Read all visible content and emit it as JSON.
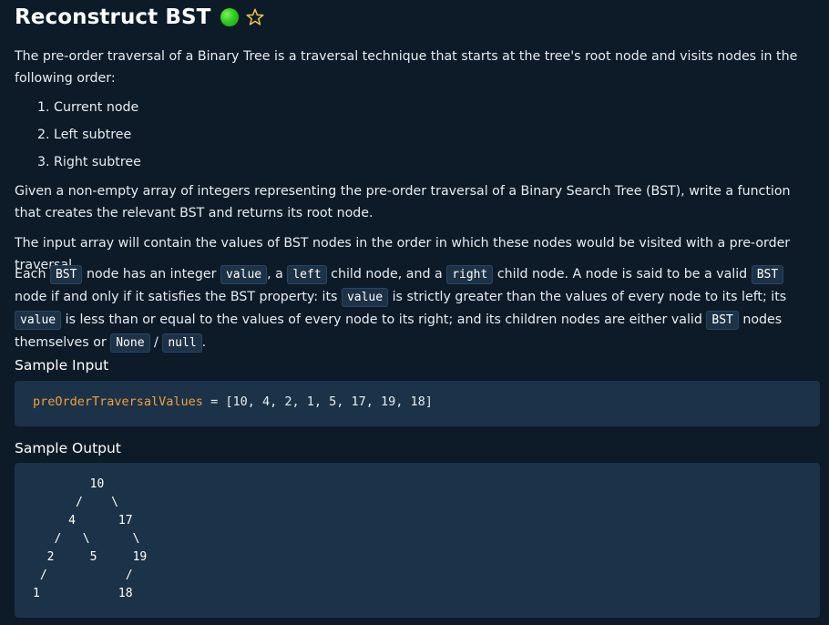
{
  "title": "Reconstruct BST",
  "status_color": "#2ecc1f",
  "star_icon": "star-outline-icon",
  "para1": "The pre-order traversal of a Binary Tree is a traversal technique that starts at the tree's root node and visits nodes in the following order:",
  "list": [
    "1. Current node",
    "2. Left subtree",
    "3. Right subtree"
  ],
  "para2": "Given a non-empty array of integers representing the pre-order traversal of a Binary Search Tree (BST), write a function that creates the relevant BST and returns its root node.",
  "para3": "The input array will contain the values of BST nodes in the order in which these nodes would be visited with a pre-order traversal.",
  "para4": {
    "t1": "Each ",
    "c1": "BST",
    "t2": " node has an integer ",
    "c2": "value",
    "t3": ", a ",
    "c3": "left",
    "t4": " child node, and a ",
    "c4": "right",
    "t5": " child node. A node is said to be a valid ",
    "c5": "BST",
    "t6": " node if and only if it satisfies the BST property: its ",
    "c6": "value",
    "t7": " is strictly greater than the values of every node to its left; its ",
    "c7": "value",
    "t8": " is less than or equal to the values of every node to its right; and its children nodes are either valid ",
    "c8": "BST",
    "t9": " nodes themselves or ",
    "c9": "None",
    "t10": " / ",
    "c10": "null",
    "t11": "."
  },
  "sample_input": {
    "heading": "Sample Input",
    "var_name": "preOrderTraversalValues",
    "rest": " = [10, 4, 2, 1, 5, 17, 19, 18]"
  },
  "sample_output": {
    "heading": "Sample Output",
    "tree": "        10\n      /    \\\n     4      17\n   /   \\      \\\n  2     5     19\n /           /\n1           18"
  },
  "colors": {
    "background": "#0d1b28",
    "code_box": "#1b3248",
    "variable": "#f0a03c"
  }
}
